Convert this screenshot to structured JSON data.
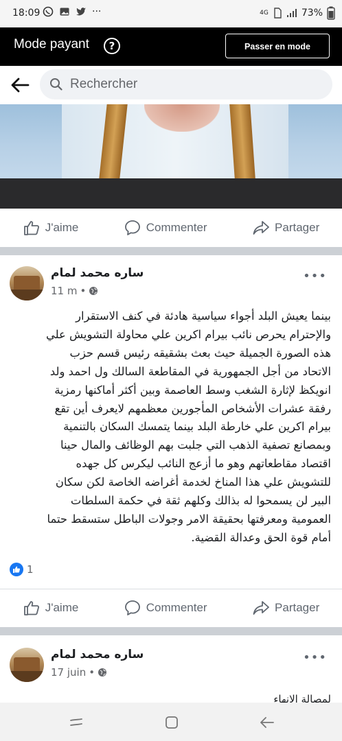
{
  "status_bar": {
    "time": "18:09",
    "signal": "4G",
    "battery": "73%"
  },
  "mode_bar": {
    "title": "Mode payant",
    "help_glyph": "?",
    "free_mode_button": "Passer en mode gratuit"
  },
  "search": {
    "placeholder": "Rechercher"
  },
  "actions": {
    "like": "J'aime",
    "comment": "Commenter",
    "share": "Partager"
  },
  "post1": {
    "author": "ساره محمد لمام",
    "time": "11 m",
    "lines": [
      "بينما يعيش البلد أجواء سياسية هادئة في كنف الاستقرار",
      "والإحترام يحرص نائب بيرام اكرين علي محاولة التشويش علي",
      "هذه الصورة الجميلة حيث بعث بشقيقه رئيس قسم حزب",
      "الاتحاد من أجل الجمهورية في المقاطعة السالك ول احمد ولد",
      "انويكظ لإثارة الشغب وسط العاصمة وبين أكثر أماكنها رمزية",
      "رفقة عشرات الأشخاص المأجورين معظمهم لايعرف أين تقع",
      "بيرام اكرين علي خارطة البلد بينما يتمسك السكان بالتنمية",
      "وبمصانع تصفية الذهب التي جلبت بهم الوظائف والمال حينا",
      "اقتصاد مقاطعاتهم وهو ما أزعج النائب ليكرس كل جهده",
      "للتشويش علي هذا المناخ لخدمة أغراضه الخاصة لكن سكان",
      "البير لن يسمحوا له بذالك وكلهم ثقة في حكمة السلطات",
      "العمومية ومعرفتها بحقيقة الامر وجولات الباطل ستسقط حتما",
      "أمام قوة الحق وعدالة القضية."
    ],
    "reaction_count": "1"
  },
  "post2": {
    "author": "ساره محمد لمام",
    "time": "17 juin",
    "preview": "لمصالة الانهاء"
  }
}
